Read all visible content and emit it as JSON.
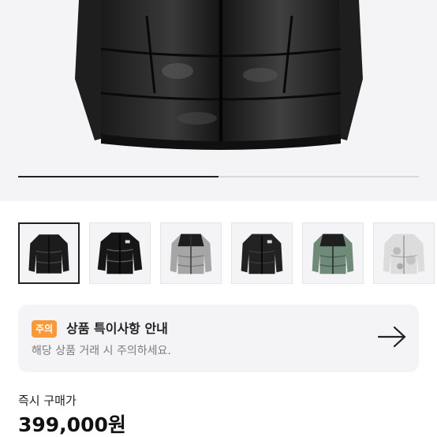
{
  "gallery": {
    "slide_progress": 0.5,
    "thumbnails": [
      {
        "icon": "black-puffer-jacket-thumbnail",
        "active": true
      },
      {
        "icon": "black-glossy-puffer-jacket-thumbnail",
        "active": false
      },
      {
        "icon": "grey-puffer-jacket-thumbnail",
        "active": false
      },
      {
        "icon": "black-matte-puffer-jacket-thumbnail",
        "active": false
      },
      {
        "icon": "green-black-puffer-jacket-thumbnail",
        "active": false
      },
      {
        "icon": "white-camo-puffer-jacket-thumbnail",
        "active": false
      }
    ]
  },
  "notice": {
    "badge": "주의",
    "title": "상품 특이사항 안내",
    "subtitle": "해당 상품 거래 시 주의하세요.",
    "arrow_icon": "arrow-right-icon"
  },
  "purchase": {
    "label": "즉시 구매가",
    "price": "399,000원"
  }
}
